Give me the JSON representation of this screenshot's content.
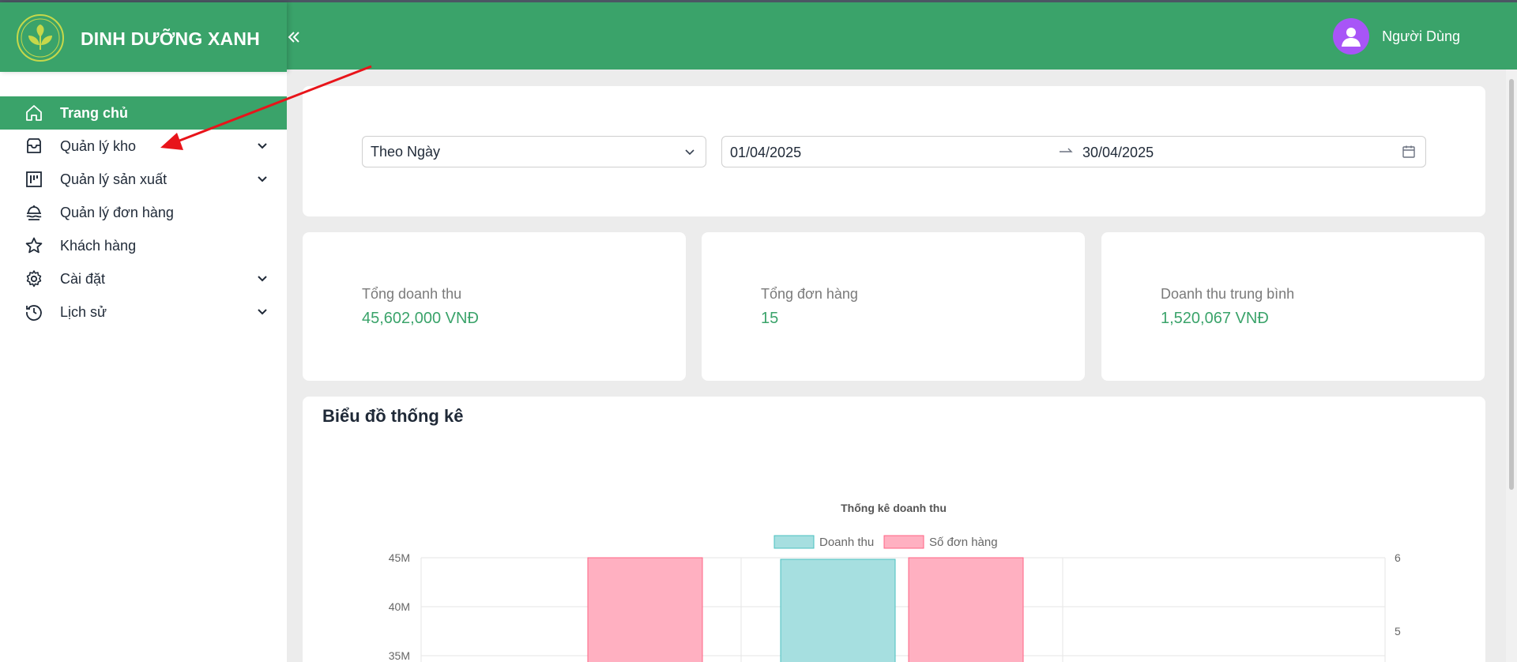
{
  "brand": {
    "title": "DINH DƯỠNG XANH"
  },
  "header": {
    "user_name": "Người Dùng"
  },
  "sidebar": {
    "items": [
      {
        "label": "Trang chủ",
        "icon": "home-icon",
        "active": true,
        "expandable": false
      },
      {
        "label": "Quản lý kho",
        "icon": "inbox-icon",
        "active": false,
        "expandable": true
      },
      {
        "label": "Quản lý sản xuất",
        "icon": "project-board-icon",
        "active": false,
        "expandable": true
      },
      {
        "label": "Quản lý đơn hàng",
        "icon": "dish-icon",
        "active": false,
        "expandable": false
      },
      {
        "label": "Khách hàng",
        "icon": "star-icon",
        "active": false,
        "expandable": false
      },
      {
        "label": "Cài đặt",
        "icon": "gear-icon",
        "active": false,
        "expandable": true
      },
      {
        "label": "Lịch sử",
        "icon": "history-clock-icon",
        "active": false,
        "expandable": true
      }
    ]
  },
  "filters": {
    "period": "Theo Ngày",
    "start_date": "01/04/2025",
    "end_date": "30/04/2025"
  },
  "stats": [
    {
      "label": "Tổng doanh thu",
      "value": "45,602,000 VNĐ"
    },
    {
      "label": "Tổng đơn hàng",
      "value": "15"
    },
    {
      "label": "Doanh thu trung bình",
      "value": "1,520,067 VNĐ"
    }
  ],
  "chart_section": {
    "heading": "Biểu đồ thống kê"
  },
  "chart_data": {
    "type": "bar",
    "title": "Thống kê doanh thu",
    "series": [
      {
        "name": "Doanh thu",
        "axis": "left",
        "color": "#a6dfe0",
        "border": "#4bc0c0",
        "values": [
          null,
          45
        ]
      },
      {
        "name": "Số đơn hàng",
        "axis": "right",
        "color": "#ffb0c1",
        "border": "#ff6384",
        "values": [
          6,
          6
        ]
      }
    ],
    "y_left_ticks": [
      "45M",
      "40M",
      "35M"
    ],
    "y_right_ticks": [
      "6",
      "5"
    ],
    "y_left_range_visible": [
      35,
      45
    ],
    "y_right_range_visible": [
      5,
      6
    ],
    "legend_position": "top",
    "grid": true
  },
  "colors": {
    "primary": "#3aa36a",
    "avatar": "#a855f7",
    "annotation_arrow": "#e8141a"
  }
}
